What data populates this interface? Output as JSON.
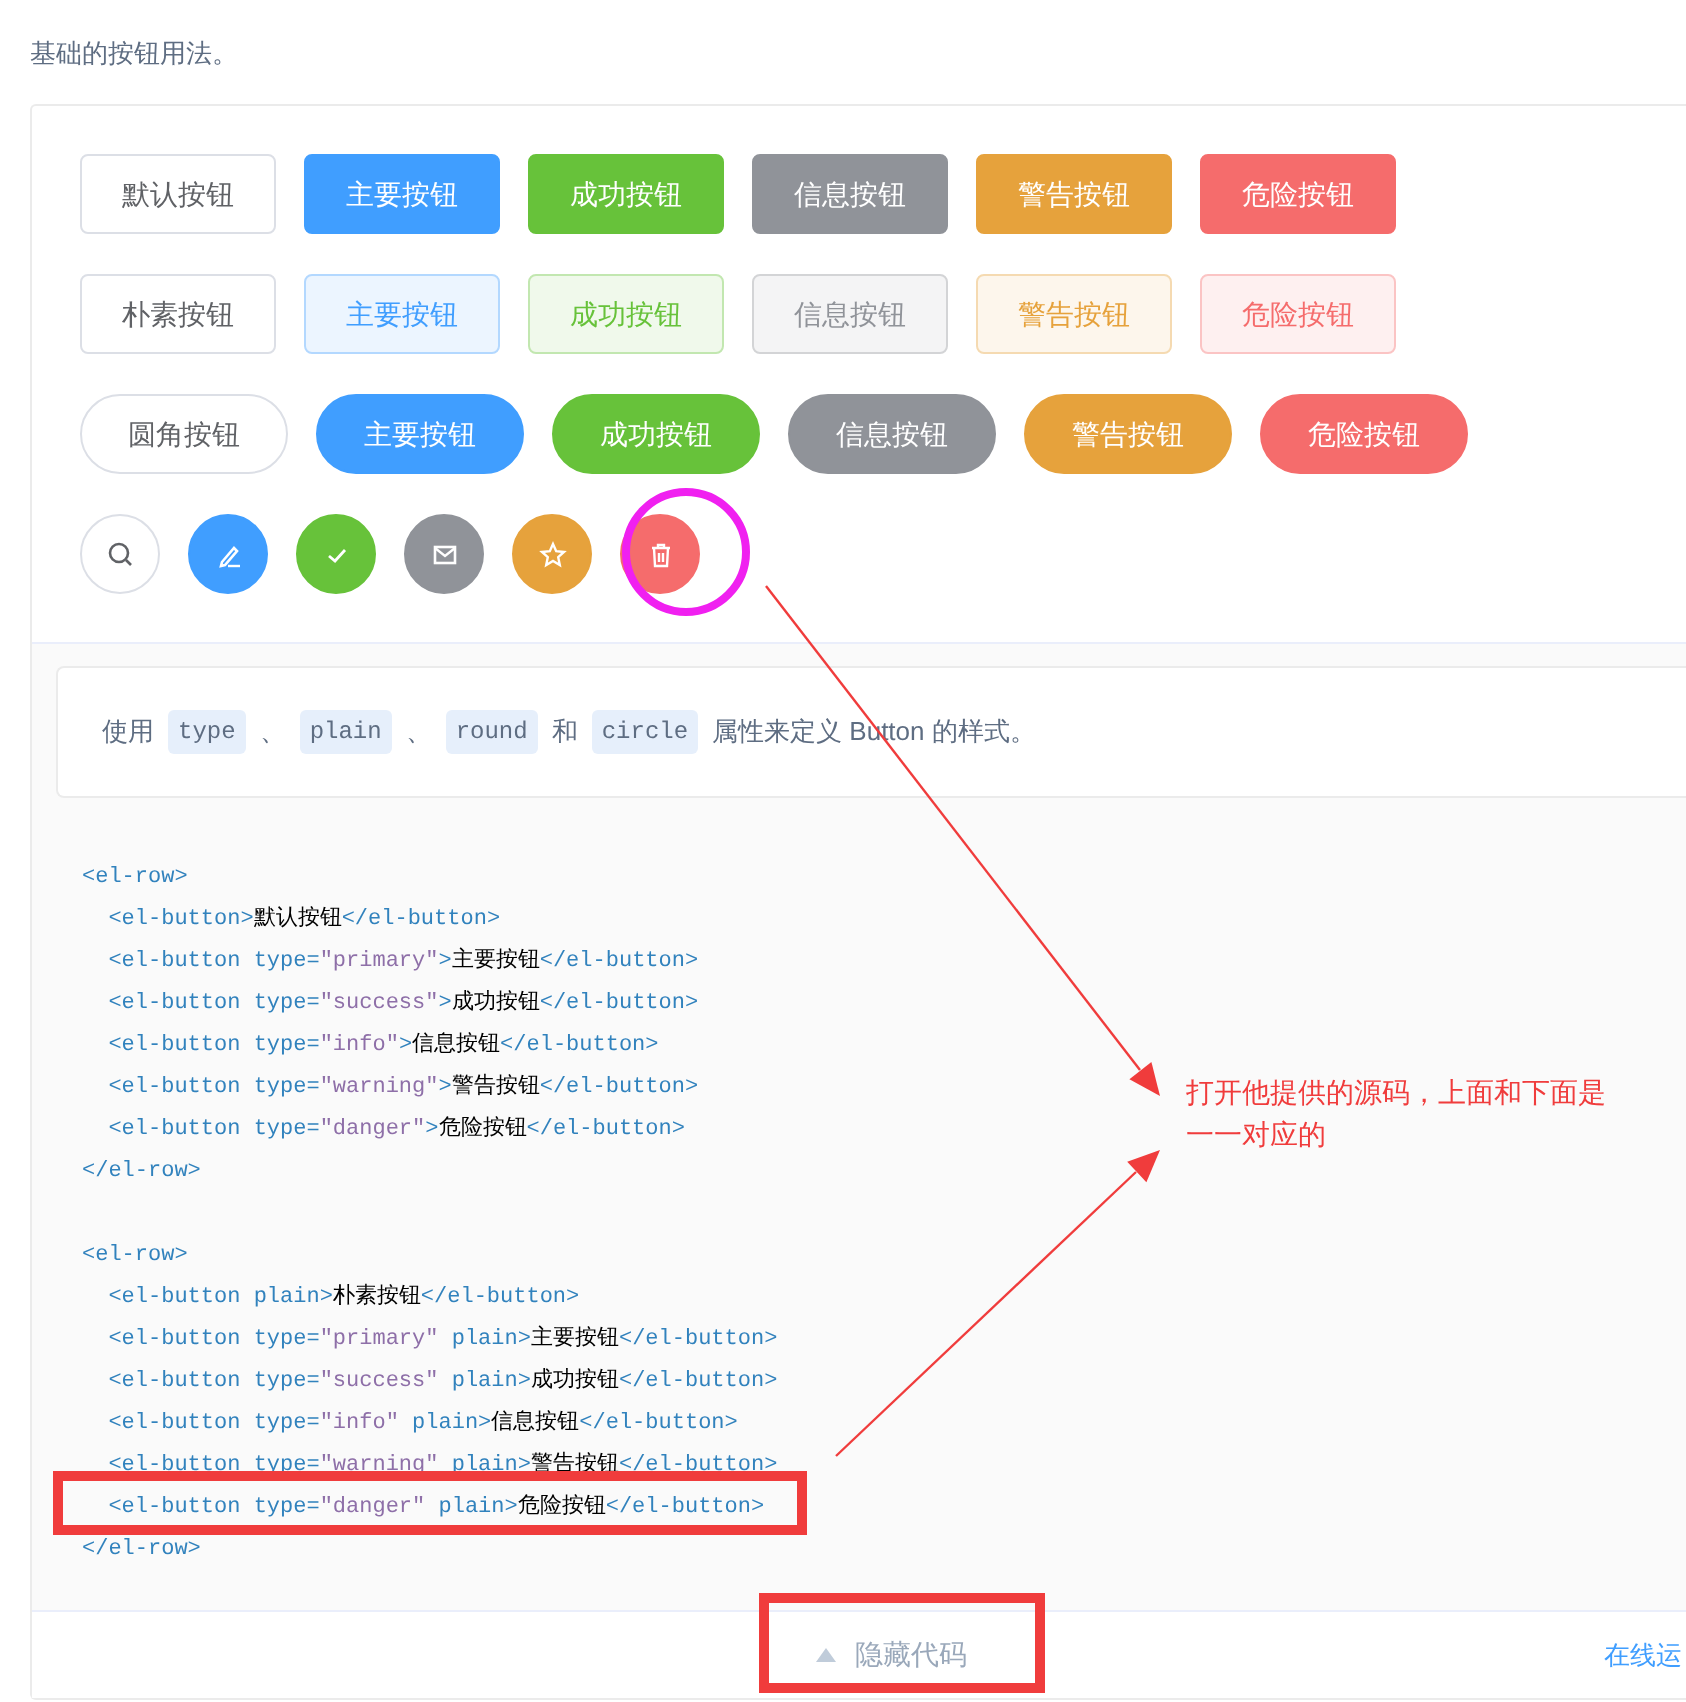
{
  "intro": "基础的按钮用法。",
  "button_rows": [
    {
      "kind": "default",
      "buttons": [
        {
          "label": "默认按钮",
          "kind": "default"
        },
        {
          "label": "主要按钮",
          "kind": "primary"
        },
        {
          "label": "成功按钮",
          "kind": "success"
        },
        {
          "label": "信息按钮",
          "kind": "info"
        },
        {
          "label": "警告按钮",
          "kind": "warning"
        },
        {
          "label": "危险按钮",
          "kind": "danger"
        }
      ]
    },
    {
      "kind": "plain",
      "buttons": [
        {
          "label": "朴素按钮",
          "kind": "default"
        },
        {
          "label": "主要按钮",
          "kind": "primary"
        },
        {
          "label": "成功按钮",
          "kind": "success"
        },
        {
          "label": "信息按钮",
          "kind": "info"
        },
        {
          "label": "警告按钮",
          "kind": "warning"
        },
        {
          "label": "危险按钮",
          "kind": "danger"
        }
      ]
    },
    {
      "kind": "round",
      "buttons": [
        {
          "label": "圆角按钮",
          "kind": "default"
        },
        {
          "label": "主要按钮",
          "kind": "primary"
        },
        {
          "label": "成功按钮",
          "kind": "success"
        },
        {
          "label": "信息按钮",
          "kind": "info"
        },
        {
          "label": "警告按钮",
          "kind": "warning"
        },
        {
          "label": "危险按钮",
          "kind": "danger"
        }
      ]
    }
  ],
  "circle_buttons": [
    {
      "kind": "default"
    },
    {
      "kind": "primary"
    },
    {
      "kind": "success"
    },
    {
      "kind": "info"
    },
    {
      "kind": "warning"
    },
    {
      "kind": "danger"
    }
  ],
  "description": [
    {
      "kind": "text",
      "text": "使用"
    },
    {
      "kind": "code",
      "text": "type"
    },
    {
      "kind": "text",
      "text": "、"
    },
    {
      "kind": "code",
      "text": "plain"
    },
    {
      "kind": "text",
      "text": "、"
    },
    {
      "kind": "code",
      "text": "round"
    },
    {
      "kind": "text",
      "text": "和"
    },
    {
      "kind": "code",
      "text": "circle"
    },
    {
      "kind": "text",
      "text": "属性来定义 Button 的样式。"
    }
  ],
  "code_blocks": [
    [
      "<el-row>",
      "  <el-button>默认按钮</el-button>",
      "  <el-button type=\"primary\">主要按钮</el-button>",
      "  <el-button type=\"success\">成功按钮</el-button>",
      "  <el-button type=\"info\">信息按钮</el-button>",
      "  <el-button type=\"warning\">警告按钮</el-button>",
      "  <el-button type=\"danger\">危险按钮</el-button>",
      "</el-row>"
    ],
    [
      "<el-row>",
      "  <el-button plain>朴素按钮</el-button>",
      "  <el-button type=\"primary\" plain>主要按钮</el-button>",
      "  <el-button type=\"success\" plain>成功按钮</el-button>",
      "  <el-button type=\"info\" plain>信息按钮</el-button>",
      "  <el-button type=\"warning\" plain>警告按钮</el-button>",
      "  <el-button type=\"danger\" plain>危险按钮</el-button>",
      "</el-row>"
    ]
  ],
  "footer": {
    "toggle": "隐藏代码",
    "link": "在线运"
  },
  "annotation": {
    "note": [
      "打开他提供的源码，上面和下面是",
      "一一对应的"
    ]
  }
}
